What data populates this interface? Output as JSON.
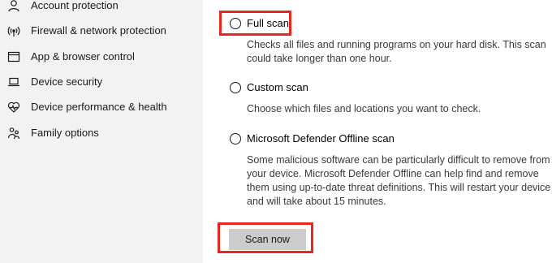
{
  "sidebar": {
    "items": [
      {
        "label": "Account protection",
        "icon": "person-icon"
      },
      {
        "label": "Firewall & network protection",
        "icon": "wifi-icon"
      },
      {
        "label": "App & browser control",
        "icon": "app-window-icon"
      },
      {
        "label": "Device security",
        "icon": "laptop-icon"
      },
      {
        "label": "Device performance & health",
        "icon": "heart-icon"
      },
      {
        "label": "Family options",
        "icon": "family-icon"
      }
    ]
  },
  "scan_options": [
    {
      "label": "Full scan",
      "selected": false,
      "description_lines": [
        "Checks all files and running programs on your hard disk. This scan",
        "could take longer than one hour."
      ]
    },
    {
      "label": "Custom scan",
      "selected": false,
      "description_lines": [
        "Choose which files and locations you want to check."
      ]
    },
    {
      "label": "Microsoft Defender Offline scan",
      "selected": false,
      "description_lines": [
        "Some malicious software can be particularly difficult to remove from",
        "your device. Microsoft Defender Offline can help find and remove",
        "them using up-to-date threat definitions. This will restart your device",
        "and will take about 15 minutes."
      ]
    }
  ],
  "actions": {
    "scan_now_label": "Scan now"
  },
  "colors": {
    "sidebar_background": "#f2f2f2",
    "highlight": "#e8261d",
    "button_background": "#cccccc"
  }
}
